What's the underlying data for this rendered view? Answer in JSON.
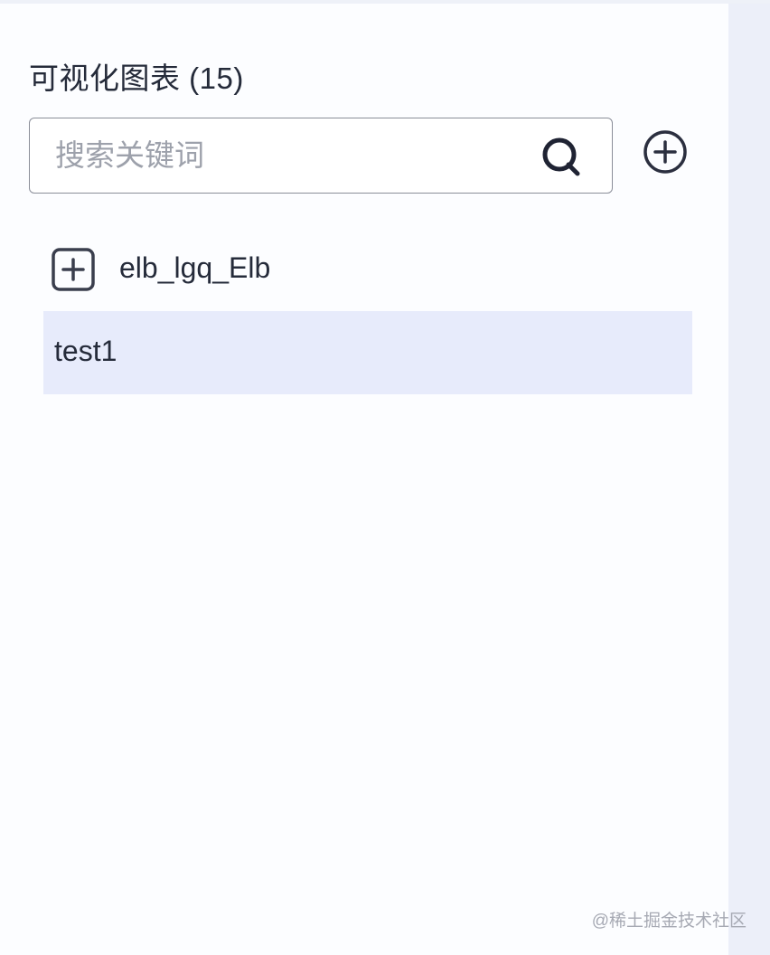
{
  "panel": {
    "title": "可视化图表 (15)"
  },
  "search": {
    "placeholder": "搜索关键词",
    "value": "",
    "icon": "search-icon"
  },
  "toolbar": {
    "add_icon": "plus-circle-icon"
  },
  "tree": {
    "folder": {
      "label": "elb_lgq_Elb",
      "icon": "plus-square-icon"
    },
    "items": [
      {
        "label": "test1",
        "selected": true
      }
    ]
  },
  "watermark": "@稀土掘金技术社区",
  "colors": {
    "text": "#252b3a",
    "selected_bg": "#e7ebfb",
    "border": "#8a8e99",
    "right_strip": "#eceff9"
  }
}
